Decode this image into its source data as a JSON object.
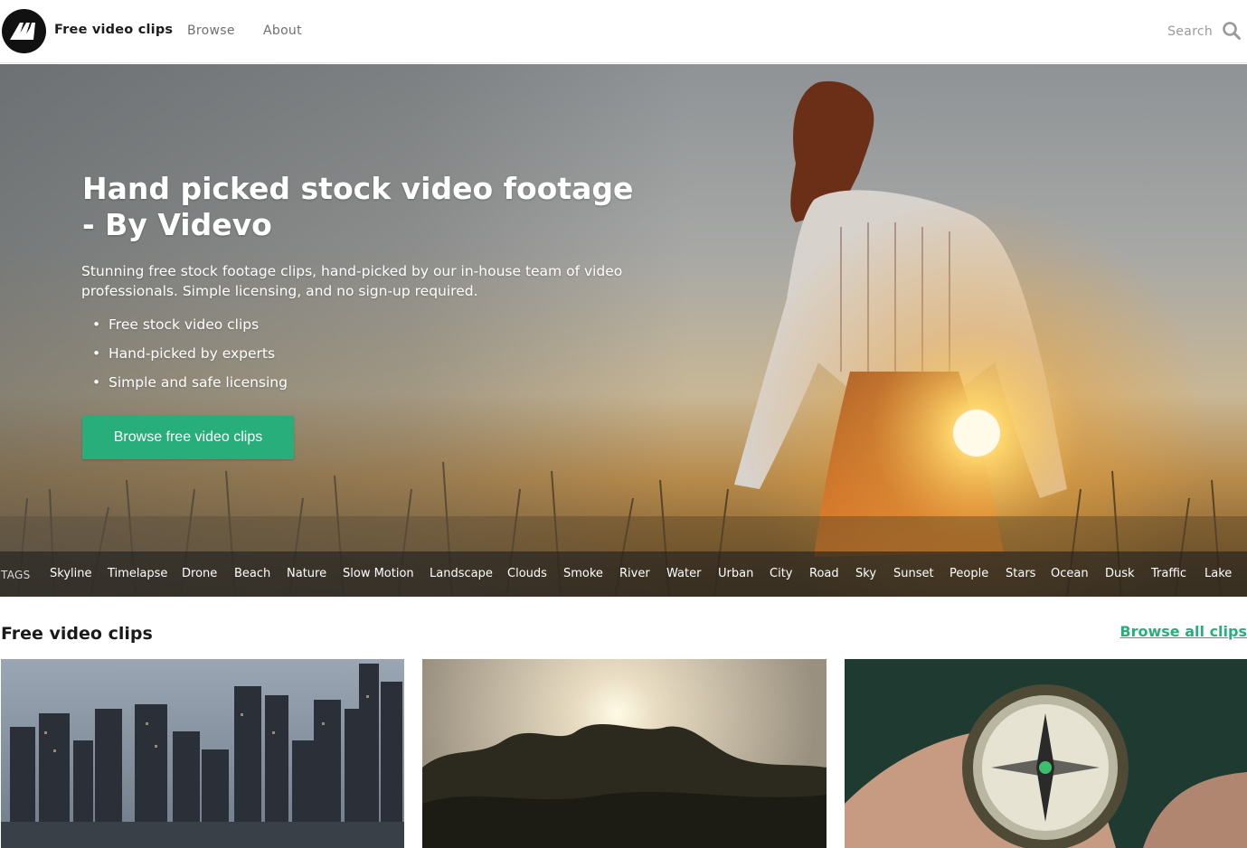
{
  "header": {
    "brand": "Free video clips",
    "nav": [
      "Browse",
      "About"
    ],
    "search_placeholder": "Search"
  },
  "hero": {
    "title_line1": "Hand picked stock video footage",
    "title_line2": "- By Videvo",
    "description": "Stunning free stock footage clips, hand-picked by our in-house team of video professionals. Simple licensing, and no sign-up required.",
    "bullets": [
      "Free stock video clips",
      "Hand-picked by experts",
      "Simple and safe licensing"
    ],
    "cta": "Browse free video clips"
  },
  "tags": {
    "label": "TAGS",
    "items": [
      "Skyline",
      "Timelapse",
      "Drone",
      "Beach",
      "Nature",
      "Slow Motion",
      "Landscape",
      "Clouds",
      "Smoke",
      "River",
      "Water",
      "Urban",
      "City",
      "Road",
      "Sky",
      "Sunset",
      "People",
      "Stars",
      "Ocean",
      "Dusk",
      "Traffic",
      "Lake"
    ]
  },
  "clips": {
    "title": "Free video clips",
    "browse_all": "Browse all clips"
  },
  "colors": {
    "accent": "#27ae7a",
    "logo": "#111111"
  },
  "icons": [
    "videvo-logo-icon",
    "search-icon"
  ]
}
